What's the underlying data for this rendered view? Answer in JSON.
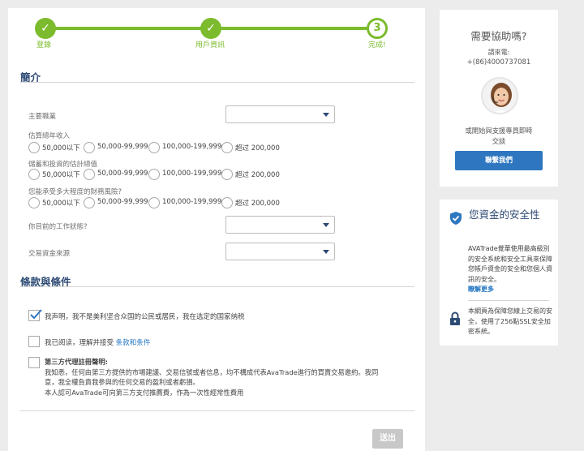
{
  "progress": {
    "steps": [
      {
        "label": "登錄",
        "state": "done"
      },
      {
        "label": "用戶資訊",
        "state": "done"
      },
      {
        "label": "完成!",
        "state": "current",
        "number": "3"
      }
    ],
    "check_glyph": "✓",
    "accent_color": "#7cbb2d"
  },
  "profile": {
    "title": "簡介",
    "occupation_label": "主要職業",
    "income": {
      "label": "估算總年收入",
      "options": [
        "50,000以下",
        "50,000-99,999",
        "100,000-199,999",
        "超过 200,000"
      ]
    },
    "savings": {
      "label": "儲蓄和投資的估計總值",
      "options": [
        "50,000以下",
        "50,000-99,999",
        "100,000-199,999",
        "超过 200,000"
      ]
    },
    "risk": {
      "label": "您能承受多大程度的財務風險?",
      "options": [
        "50,000以下",
        "50,000-99,999",
        "100,000-199,999",
        "超过 200,000"
      ]
    },
    "employment_label": "你目前的工作狀態?",
    "funds_source_label": "交易資金來源"
  },
  "terms": {
    "title": "條款與條件",
    "declaration": "我声明，我不是美利坚合众国的公民或居民，我在选定的国家纳税",
    "declaration_checked": true,
    "agree_prefix": "我已阅读，理解并接受 ",
    "agree_link": "条款和条件",
    "third_party_title": "第三方代理註冊聲明:",
    "third_party_line1": "我知悉，任何由第三方提供的市場建議、交易信號或者信息，均不構成代表AvaTrade進行的買賣交易邀約。我同",
    "third_party_line2": "意，我全權負責我參與的任何交易的盈利或者虧損。",
    "third_party_line3": "本人認可AvaTrade可向第三方支付推薦費，作為一次性經常性費用"
  },
  "submit_label": "送出",
  "help": {
    "title": "需要協助嗎?",
    "call_label": "請來電:",
    "phone": "+(86)4000737081",
    "text_line1": "或開始與支援專員即時",
    "text_line2": "交談",
    "button_label": "聯繫我們",
    "button_color": "#2e77c0"
  },
  "security": {
    "title": "您資金的安全性",
    "body": "AVATrade覺華使用最高級別的安全系統和安全工具來保障您帳戶資金的安全和您個人資訊的安全。",
    "learn_more": "瞭解更多",
    "ssl_text": "本網頁為保障您線上交易的安全，使用了256點SSL安全加密系統。",
    "shield_icon": "shield-check-icon",
    "lock_icon": "lock-icon"
  }
}
